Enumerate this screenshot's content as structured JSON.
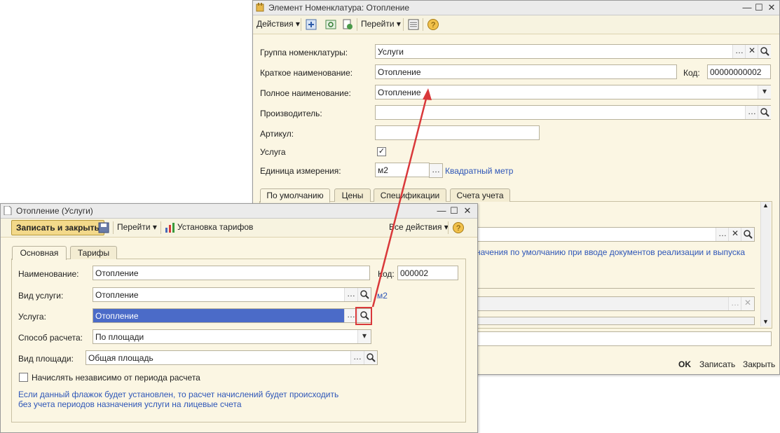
{
  "back_window": {
    "title": "Элемент Номенклатура: Отопление",
    "toolbar": {
      "actions": "Действия ▾",
      "goto": "Перейти ▾"
    },
    "fields": {
      "group_label": "Группа номенклатуры:",
      "group_value": "Услуги",
      "short_label": "Краткое наименование:",
      "short_value": "Отопление",
      "code_label": "Код:",
      "code_value": "00000000002",
      "full_label": "Полное наименование:",
      "full_value": "Отопление",
      "maker_label": "Производитель:",
      "maker_value": "",
      "article_label": "Артикул:",
      "article_value": "",
      "service_label": "Услуга",
      "unit_label": "Единица измерения:",
      "unit_value": "м2",
      "unit_link": "Квадратный метр"
    },
    "tabs": [
      "По умолчанию",
      "Цены",
      "Спецификации",
      "Счета учета"
    ],
    "partial_text": "начения по умолчанию при вводе документов  реализации и выпуска",
    "footer": {
      "ok": "OK",
      "write": "Записать",
      "close": "Закрыть"
    }
  },
  "front_window": {
    "title": "Отопление (Услуги)",
    "toolbar": {
      "save_close": "Записать и закрыть",
      "goto": "Перейти ▾",
      "tariffs": "Установка тарифов",
      "all_actions": "Все действия ▾"
    },
    "tabs": [
      "Основная",
      "Тарифы"
    ],
    "fields": {
      "name_label": "Наименование:",
      "name_value": "Отопление",
      "code_label": "Код:",
      "code_value": "000002",
      "kind_label": "Вид услуги:",
      "kind_value": "Отопление",
      "service_label": "Услуга:",
      "service_value": "Отопление",
      "calc_label": "Способ расчета:",
      "calc_value": "По площади",
      "area_label": "Вид площади:",
      "area_value": "Общая площадь",
      "independent_label": "Начислять независимо от периода расчета"
    },
    "hint_line1": "Если данный флажок будет установлен, то расчет начислений будет происходить",
    "hint_line2": "без учета периодов назначения услуги на лицевые счета",
    "peek_m2": "м2"
  },
  "colors": {
    "accent_red": "#d9383a",
    "selection": "#4b6bc8",
    "link": "#2e56b8",
    "bg": "#fbf6e3"
  }
}
